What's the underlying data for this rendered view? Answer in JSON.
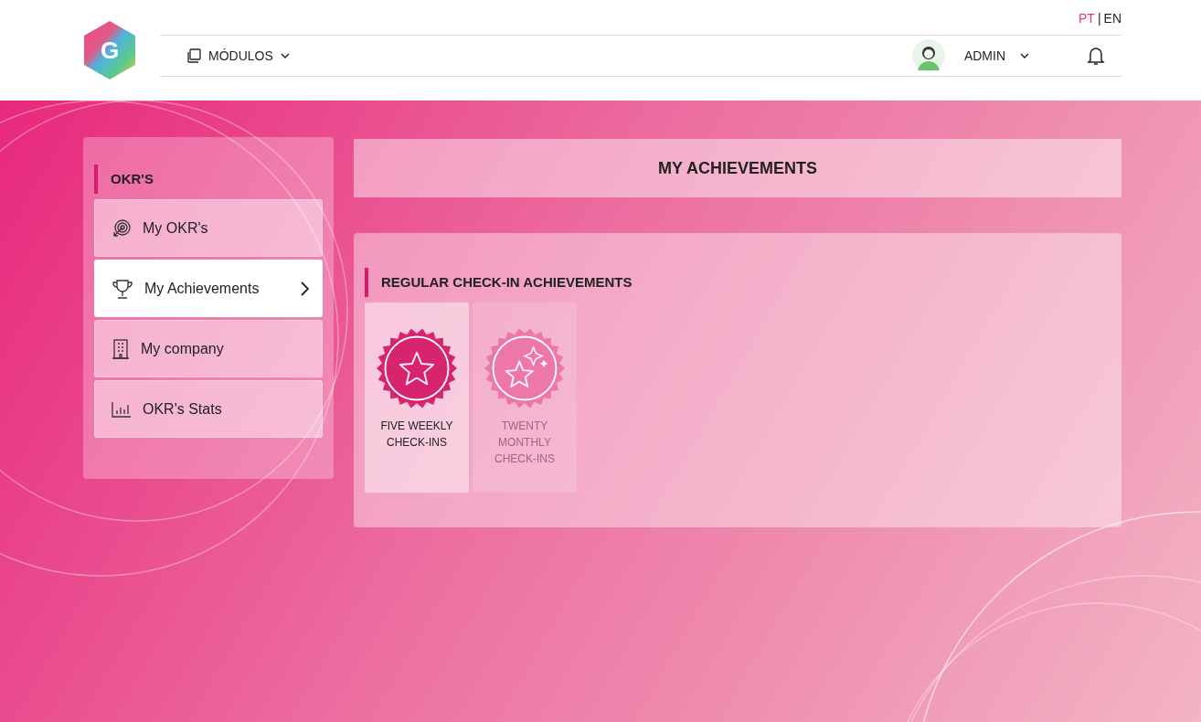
{
  "header": {
    "logo_letter": "G",
    "languages": [
      {
        "label": "PT",
        "selected": true
      },
      {
        "label": "EN",
        "selected": false
      }
    ],
    "language_separator": "|",
    "modules_menu": "MÓDULOS",
    "user_menu": "ADMIN"
  },
  "sidebar": {
    "title": "OKR'S",
    "items": [
      {
        "label": "My OKR's",
        "kind": "target",
        "selected": false
      },
      {
        "label": "My Achievements",
        "kind": "trophy",
        "selected": true
      },
      {
        "label": "My company",
        "kind": "building",
        "selected": false
      },
      {
        "label": "OKR's Stats",
        "kind": "chart",
        "selected": false
      }
    ]
  },
  "page_title": "MY ACHIEVEMENTS",
  "section": {
    "title": "REGULAR CHECK-IN ACHIEVEMENTS",
    "achievements": [
      {
        "label": "FIVE WEEKLY CHECK-INS",
        "kind": "star",
        "earned": true
      },
      {
        "label": "TWENTY MONTHLY CHECK-INS",
        "kind": "sparkle",
        "earned": false
      }
    ]
  }
}
